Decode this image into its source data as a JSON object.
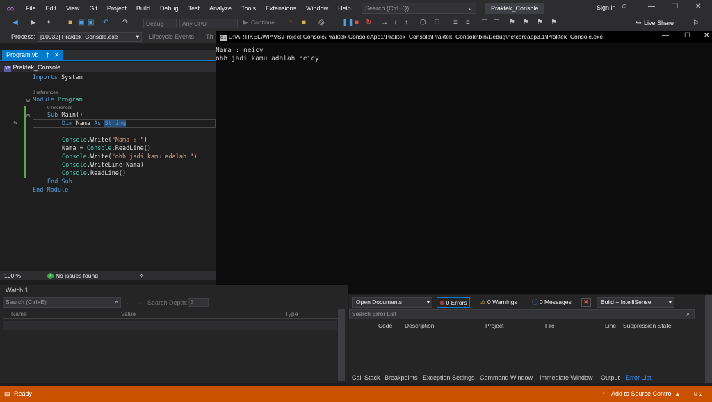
{
  "menu": {
    "items": [
      "File",
      "Edit",
      "View",
      "Git",
      "Project",
      "Build",
      "Debug",
      "Test",
      "Analyze",
      "Tools",
      "Extensions",
      "Window",
      "Help"
    ],
    "search_placeholder": "Search (Ctrl+Q)",
    "solution_name": "Praktek_Console",
    "sign_in": "Sign in"
  },
  "toolbar": {
    "config": "Debug",
    "platform": "Any CPU",
    "continue_label": "Continue",
    "live_share": "Live Share"
  },
  "process_bar": {
    "label": "Process:",
    "value": "[10932] Praktek_Console.exe",
    "lifecycle": "Lifecycle Events",
    "th": "Th"
  },
  "editor": {
    "tab": "Program.vb",
    "nav_project": "Praktek_Console",
    "references": "0 references",
    "code": {
      "imports_kw": "Imports",
      "imports_ns": "System",
      "module_kw": "Module",
      "module_name": "Program",
      "sub_kw": "Sub",
      "sub_name": "Main()",
      "dim_kw": "Dim",
      "var": "Nama",
      "as_kw": "As",
      "string_ty": "String",
      "console": "Console",
      "write": ".Write(",
      "str_nama": "\"Nama : \"",
      "close": ")",
      "assign": "Nama = ",
      "readline": ".ReadLine()",
      "str_ohh": "\"ohh jadi kamu adalah \"",
      "writeline": ".WriteLine(Nama)",
      "end_kw": "End",
      "end_sub": "Sub",
      "end_module": "Module"
    },
    "zoom": "100 %",
    "issues": "No issues found"
  },
  "console": {
    "title": "D:\\ARTIKEL\\WP\\VS\\Project Console\\Praktek-ConsoleApp1\\Praktek_Console\\Praktek_Console\\bin\\Debug\\netcoreapp3.1\\Praktek_Console.exe",
    "lines": [
      "Nama : neicy",
      "ohh jadi kamu adalah neicy"
    ]
  },
  "watch": {
    "title": "Watch 1",
    "search_placeholder": "Search (Ctrl+E)",
    "search_depth_label": "Search Depth:",
    "search_depth_value": "3",
    "columns": [
      "Name",
      "Value",
      "Type"
    ]
  },
  "error_list": {
    "scope": "Open Documents",
    "errors": "0 Errors",
    "warnings": "0 Warnings",
    "messages": "0 Messages",
    "build_filter": "Build + IntelliSense",
    "search_placeholder": "Search Error List",
    "columns": [
      "Code",
      "Description",
      "Project",
      "File",
      "Line",
      "Suppression State"
    ]
  },
  "bottom_tabs": [
    "Call Stack",
    "Breakpoints",
    "Exception Settings",
    "Command Window",
    "Immediate Window",
    "Output",
    "Error List"
  ],
  "status": {
    "ready": "Ready",
    "source_control": "Add to Source Control",
    "notifications": "2"
  },
  "colors": {
    "accent": "#007acc",
    "statusbar_debug": "#ca5100"
  }
}
